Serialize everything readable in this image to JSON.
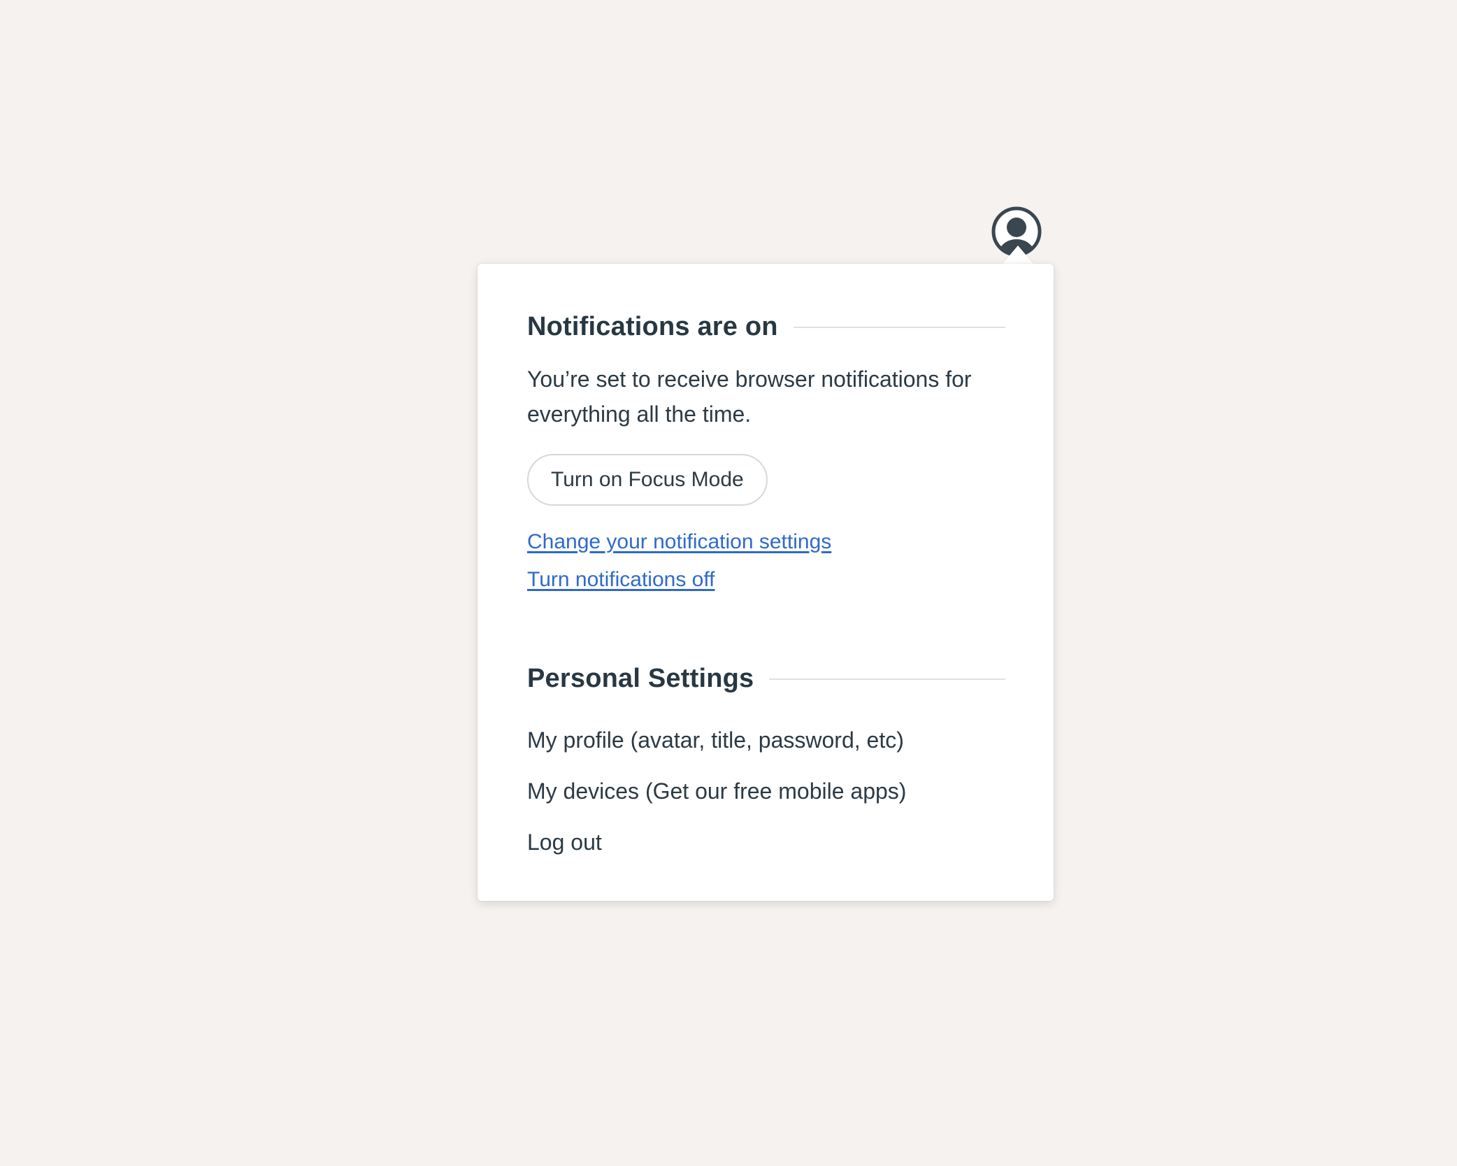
{
  "avatar": {
    "icon": "user-avatar-icon",
    "color": "#3a4750"
  },
  "notifications": {
    "heading": "Notifications are on",
    "description": "You’re set to receive browser notifications for everything all the time.",
    "focus_button_label": "Turn on Focus Mode",
    "change_settings_link": "Change your notification settings",
    "turn_off_link": "Turn notifications off",
    "link_color": "#2f6ac9"
  },
  "personal_settings": {
    "heading": "Personal Settings",
    "items": [
      {
        "label": "My profile (avatar, title, password, etc)"
      },
      {
        "label": "My devices (Get our free mobile apps)"
      },
      {
        "label": "Log out"
      }
    ]
  }
}
